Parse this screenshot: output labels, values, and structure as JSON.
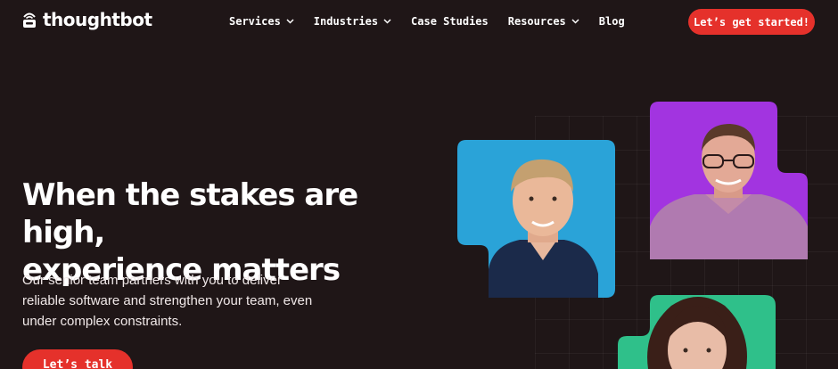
{
  "brand": {
    "name": "thoughtbot",
    "logo_icon": "robot-icon"
  },
  "nav": {
    "items": [
      {
        "label": "Services",
        "has_dropdown": true
      },
      {
        "label": "Industries",
        "has_dropdown": true
      },
      {
        "label": "Case Studies",
        "has_dropdown": false
      },
      {
        "label": "Resources",
        "has_dropdown": true
      },
      {
        "label": "Blog",
        "has_dropdown": false
      }
    ],
    "cta_label": "Let’s get started!"
  },
  "hero": {
    "title_line1": "When the stakes are high,",
    "title_line2": "experience matters",
    "subtitle_line1": "Our senior team partners with you to deliver",
    "subtitle_line2": "reliable software and strengthen your team, even",
    "subtitle_line3": "under complex constraints.",
    "cta_label": "Let’s talk"
  },
  "portraits": [
    {
      "name": "portrait-blue",
      "bg": "#2aa3d8"
    },
    {
      "name": "portrait-purple",
      "bg": "#a234e0"
    },
    {
      "name": "portrait-green",
      "bg": "#2fc08a"
    }
  ],
  "colors": {
    "background": "#1f1617",
    "accent": "#e5312b"
  }
}
